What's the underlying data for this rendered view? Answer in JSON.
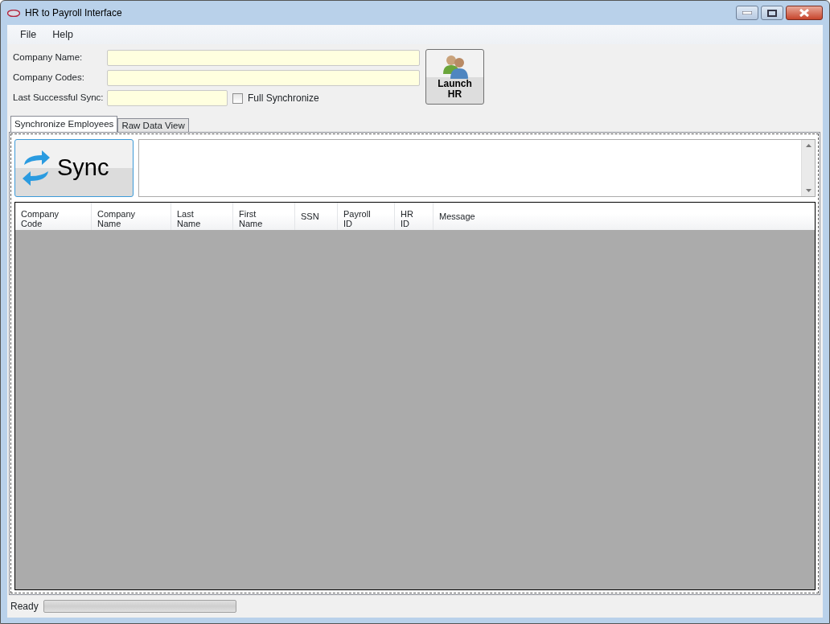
{
  "window": {
    "title": "HR to Payroll Interface"
  },
  "menu": [
    "File",
    "Help"
  ],
  "fields": [
    {
      "label": "Company Name:",
      "kind": "wide"
    },
    {
      "label": "Company Codes:",
      "kind": "wide"
    },
    {
      "label": "Last Successful Sync:",
      "kind": "short"
    }
  ],
  "full_sync": {
    "label": "Full Synchronize",
    "checked": false
  },
  "launch_button": {
    "label": "Launch HR"
  },
  "tabs": [
    {
      "label": "Synchronize Employees",
      "selected": true
    },
    {
      "label": "Raw Data View",
      "selected": false
    }
  ],
  "sync_button": {
    "label": "Sync"
  },
  "table": {
    "columns": [
      "Company Code",
      "Company Name",
      "Last Name",
      "First Name",
      "SSN",
      "Payroll ID",
      "HR ID",
      "Message"
    ]
  },
  "status_bar": {
    "text": "Ready",
    "progress": {
      "level": 0
    }
  }
}
